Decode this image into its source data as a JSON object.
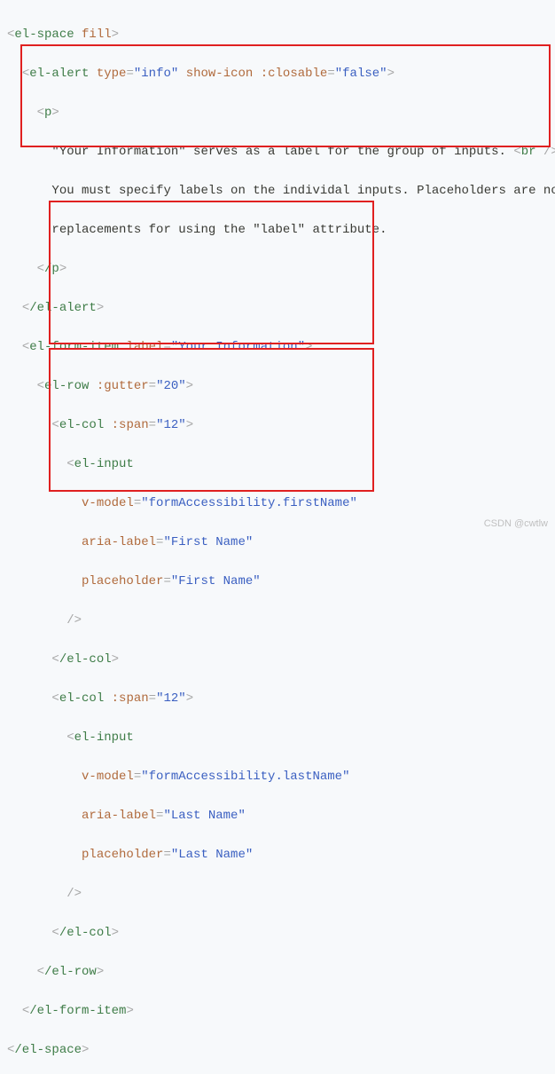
{
  "code": {
    "l1": {
      "t": "el-space",
      "a": "fill"
    },
    "l2": {
      "t": "el-alert",
      "a1n": "type",
      "a1v": "\"info\"",
      "a2": "show-icon",
      "a3n": ":closable",
      "a3v": "\"false\""
    },
    "l3": {
      "t": "p"
    },
    "l4": "\"Your Information\" serves as a label for the group of inputs. ",
    "l4b": {
      "t": "br"
    },
    "l5": "You must specify labels on the individal inputs. Placeholders are not",
    "l6": "replacements for using the \"label\" attribute.",
    "l7": {
      "t": "/p"
    },
    "l8": {
      "t": "/el-alert"
    },
    "l9": {
      "t": "el-form-item",
      "a1n": "label",
      "a1v": "\"Your Information\""
    },
    "l10": {
      "t": "el-row",
      "a1n": ":gutter",
      "a1v": "\"20\""
    },
    "l11": {
      "t": "el-col",
      "a1n": ":span",
      "a1v": "\"12\""
    },
    "l12": {
      "t": "el-input"
    },
    "l13": {
      "a1n": "v-model",
      "a1v": "\"formAccessibility.firstName\""
    },
    "l14": {
      "a1n": "aria-label",
      "a1v": "\"First Name\""
    },
    "l15": {
      "a1n": "placeholder",
      "a1v": "\"First Name\""
    },
    "l17": {
      "t": "/el-col"
    },
    "l18": {
      "t": "el-col",
      "a1n": ":span",
      "a1v": "\"12\""
    },
    "l19": {
      "t": "el-input"
    },
    "l20": {
      "a1n": "v-model",
      "a1v": "\"formAccessibility.lastName\""
    },
    "l21": {
      "a1n": "aria-label",
      "a1v": "\"Last Name\""
    },
    "l22": {
      "a1n": "placeholder",
      "a1v": "\"Last Name\""
    },
    "l24": {
      "t": "/el-col"
    },
    "l25": {
      "t": "/el-row"
    },
    "l26": {
      "t": "/el-form-item"
    },
    "l27": {
      "t": "/el-space"
    }
  },
  "watermark": "CSDN  @cwtlw"
}
